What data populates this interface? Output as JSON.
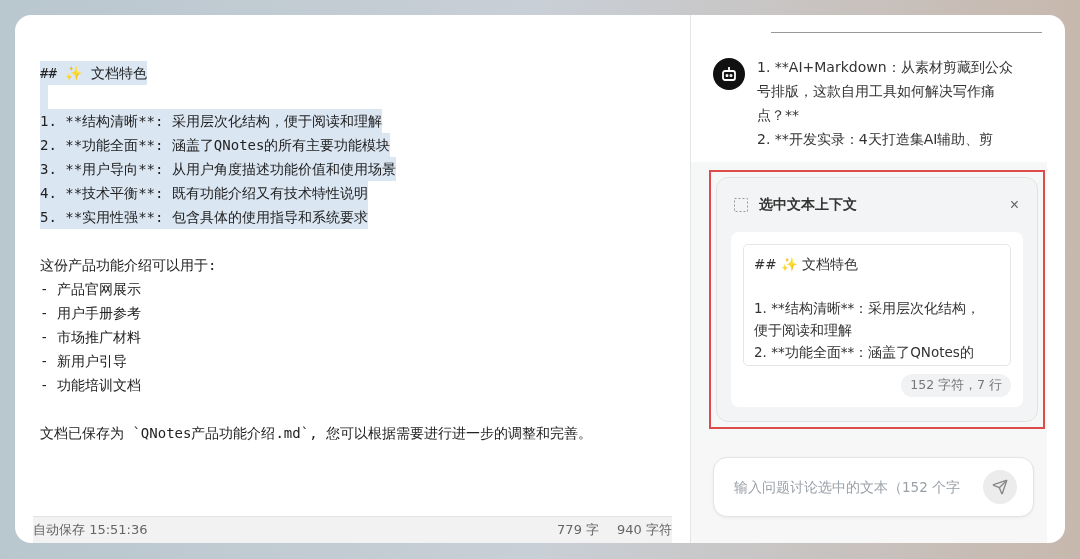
{
  "editor": {
    "paragraphs": [
      {
        "lines": [
          {
            "text": "## ✨ 文档特色",
            "selected": true
          }
        ]
      },
      {
        "lines": [
          {
            "text": "1. **结构清晰**: 采用层次化结构，便于阅读和理解",
            "selected": true
          },
          {
            "text": "2. **功能全面**: 涵盖了QNotes的所有主要功能模块",
            "selected": true
          },
          {
            "text": "3. **用户导向**: 从用户角度描述功能价值和使用场景",
            "selected": true
          },
          {
            "text": "4. **技术平衡**: 既有功能介绍又有技术特性说明",
            "selected": true
          },
          {
            "text": "5. **实用性强**: 包含具体的使用指导和系统要求",
            "selected": true
          }
        ]
      },
      {
        "lines": [
          {
            "text": "这份产品功能介绍可以用于:",
            "selected": false
          },
          {
            "text": "- 产品官网展示",
            "selected": false
          },
          {
            "text": "- 用户手册参考",
            "selected": false
          },
          {
            "text": "- 市场推广材料",
            "selected": false
          },
          {
            "text": "- 新用户引导",
            "selected": false
          },
          {
            "text": "- 功能培训文档",
            "selected": false
          }
        ]
      },
      {
        "lines": [
          {
            "text": "文档已保存为 `QNotes产品功能介绍.md`, 您可以根据需要进行进一步的调整和完善。",
            "selected": false
          }
        ]
      }
    ]
  },
  "status_bar": {
    "autosave": "自动保存 15:51:36",
    "words": "779 字",
    "chars": "940 字符"
  },
  "chat": {
    "message_lines": [
      "1. **AI+Markdown：从素材剪藏到公众",
      "号排版，这款自用工具如何解决写作痛",
      "点？**",
      "2. **开发实录：4天打造集AI辅助、剪"
    ]
  },
  "context_panel": {
    "title": "选中文本上下文",
    "close": "×",
    "preview_paragraphs": [
      [
        "## ✨ 文档特色"
      ],
      [
        "1. **结构清晰**：采用层次化结构，",
        "便于阅读和理解",
        "2. **功能全面**：涵盖了QNotes的"
      ]
    ],
    "stats": "152 字符，7 行"
  },
  "input": {
    "placeholder": "输入问题讨论选中的文本（152 个字"
  }
}
